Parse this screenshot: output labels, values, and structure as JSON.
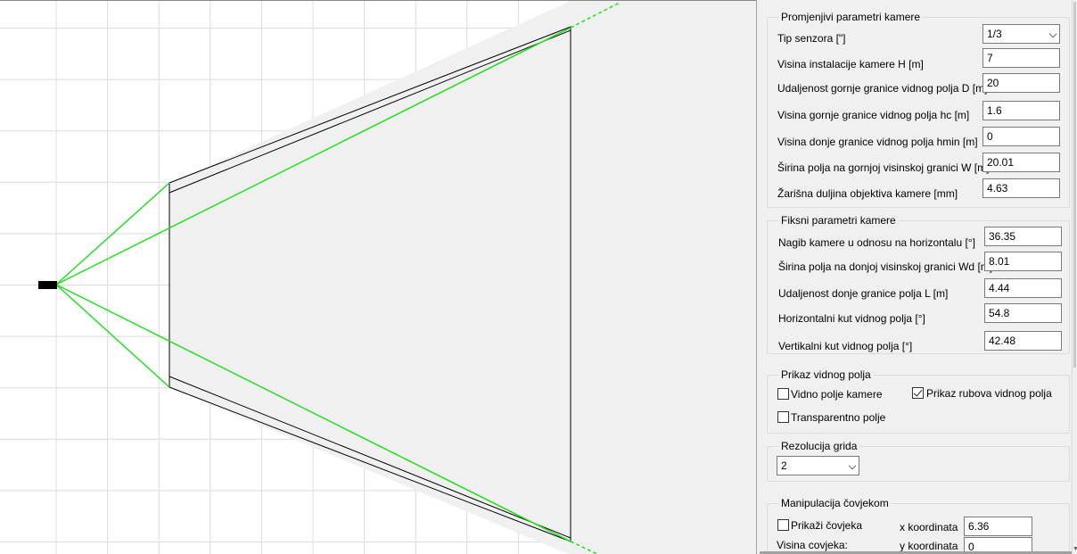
{
  "variable_params": {
    "title": "Promjenjivi parametri kamere",
    "sensor_type": {
      "label": "Tip senzora [\"]",
      "value": "1/3"
    },
    "fields": [
      {
        "label": "Visina instalacije kamere H [m]",
        "value": "7"
      },
      {
        "label": "Udaljenost gornje granice vidnog polja D [m]",
        "value": "20"
      },
      {
        "label": "Visina gornje granice vidnog polja hc [m]",
        "value": "1.6"
      },
      {
        "label": "Visina donje granice vidnog polja hmin [m]",
        "value": "0"
      },
      {
        "label": "Širina polja na gornjoj visinskoj granici W [m]",
        "value": "20.01"
      },
      {
        "label": "Žarišna duljina objektiva kamere [mm]",
        "value": "4.63"
      }
    ]
  },
  "fixed_params": {
    "title": "Fiksni parametri kamere",
    "fields": [
      {
        "label": "Nagib kamere u odnosu na horizontalu [°]",
        "value": "36.35"
      },
      {
        "label": "Širina polja na donjoj visinskoj granici Wd [m]",
        "value": "8.01"
      },
      {
        "label": "Udaljenost donje granice polja L [m]",
        "value": "4.44"
      },
      {
        "label": "Horizontalni kut vidnog polja [°]",
        "value": "54.8"
      },
      {
        "label": "Vertikalni kut vidnog polja [°]",
        "value": "42.48"
      }
    ]
  },
  "display": {
    "title": "Prikaz vidnog polja",
    "options": [
      {
        "label": "Vidno polje kamere",
        "checked": false
      },
      {
        "label": "Prikaz rubova vidnog polja",
        "checked": true
      },
      {
        "label": "Transparentno polje",
        "checked": false
      }
    ]
  },
  "grid": {
    "title": "Rezolucija grida",
    "value": "2"
  },
  "person": {
    "title": "Manipulacija čovjekom",
    "show_label": "Prikaži čovjeka",
    "show_checked": false,
    "height_label": "Visina covjeka:",
    "x_label": "x koordinata",
    "x_value": "6.36",
    "y_label": "y koordinata",
    "y_value": "0"
  },
  "colors": {
    "fov_line": "#22dd22",
    "field_fill": "#f0f0f0",
    "grid_line": "#dcdcdc",
    "camera": "#000000"
  }
}
